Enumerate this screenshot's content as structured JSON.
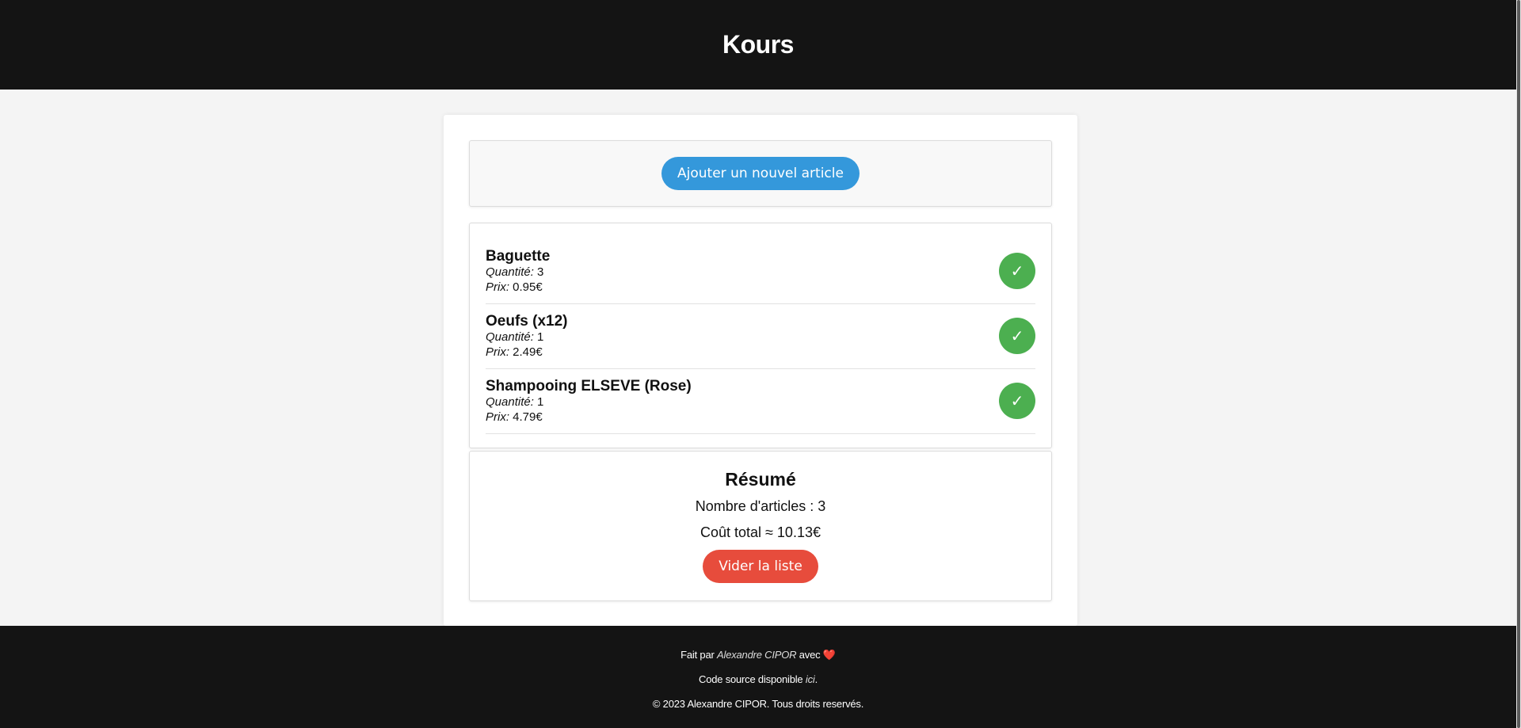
{
  "header": {
    "title": "Kours"
  },
  "add_panel": {
    "button_label": "Ajouter un nouvel article"
  },
  "items": [
    {
      "name": "Baguette",
      "quantity_label": "Quantité:",
      "quantity": "3",
      "price_label": "Prix:",
      "price": "0.95€",
      "check_icon": "✓"
    },
    {
      "name": "Oeufs (x12)",
      "quantity_label": "Quantité:",
      "quantity": "1",
      "price_label": "Prix:",
      "price": "2.49€",
      "check_icon": "✓"
    },
    {
      "name": "Shampooing ELSEVE (Rose)",
      "quantity_label": "Quantité:",
      "quantity": "1",
      "price_label": "Prix:",
      "price": "4.79€",
      "check_icon": "✓"
    }
  ],
  "summary": {
    "title": "Résumé",
    "count_text": "Nombre d'articles : 3",
    "total_text": "Coût total ≈ 10.13€",
    "clear_label": "Vider la liste"
  },
  "footer": {
    "made_prefix": "Fait par",
    "author": "Alexandre CIPOR",
    "made_suffix": "avec",
    "heart": "❤️",
    "source_prefix": "Code source disponible",
    "source_link": "ici",
    "source_suffix": ".",
    "copyright": "© 2023 Alexandre CIPOR. Tous droits reservés."
  },
  "colors": {
    "header_bg": "#141414",
    "add_button": "#3498db",
    "check_button": "#4caf50",
    "clear_button": "#e74c3c"
  }
}
